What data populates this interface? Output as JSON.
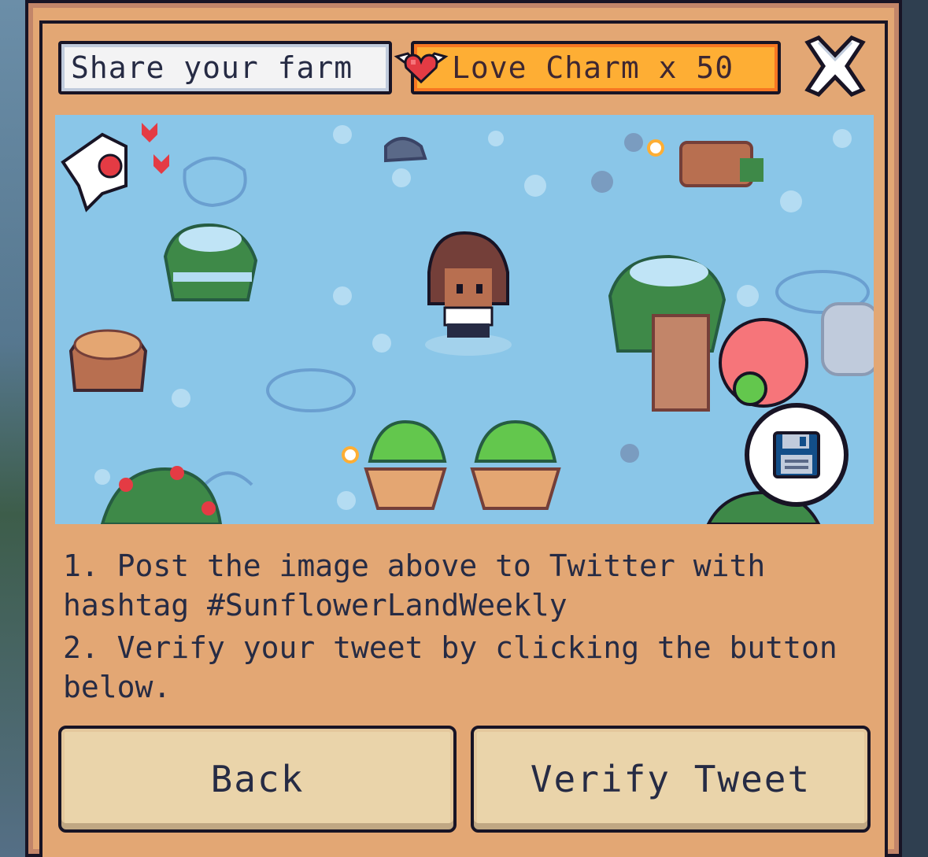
{
  "header": {
    "share_label": "Share your farm",
    "charm_label": "Love Charm x 50"
  },
  "instructions": {
    "step1": "1. Post the image above to Twitter with hashtag #SunflowerLandWeekly",
    "step2": "2. Verify your tweet by clicking the button below."
  },
  "buttons": {
    "back": "Back",
    "verify": "Verify Tweet"
  },
  "icons": {
    "close": "close-icon",
    "heart": "winged-heart-icon",
    "save": "floppy-disk-icon"
  },
  "colors": {
    "panel": "#e3a774",
    "charm": "#feae34",
    "button": "#ead4aa",
    "scene": "#8ac6e8",
    "outline": "#181425"
  }
}
